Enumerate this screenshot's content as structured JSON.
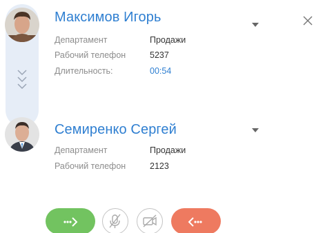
{
  "contacts": [
    {
      "name": "Максимов Игорь",
      "fields": [
        {
          "label": "Департамент",
          "value": "Продажи"
        },
        {
          "label": "Рабочий телефон",
          "value": "5237"
        },
        {
          "label": "Длительность:",
          "value": "00:54"
        }
      ]
    },
    {
      "name": "Семиренко Сергей",
      "fields": [
        {
          "label": "Департамент",
          "value": "Продажи"
        },
        {
          "label": "Рабочий телефон",
          "value": "2123"
        }
      ]
    }
  ],
  "icons": {
    "close": "close-icon",
    "caret": "caret-down-icon",
    "expand": "chevrons-down-icon",
    "transfer": "transfer-call-icon",
    "mute": "microphone-muted-icon",
    "video": "video-off-icon",
    "end": "end-call-icon"
  },
  "colors": {
    "accent": "#2f7fd1",
    "transfer": "#72c360",
    "end": "#ee7a60",
    "rail": "#e6edf7"
  }
}
